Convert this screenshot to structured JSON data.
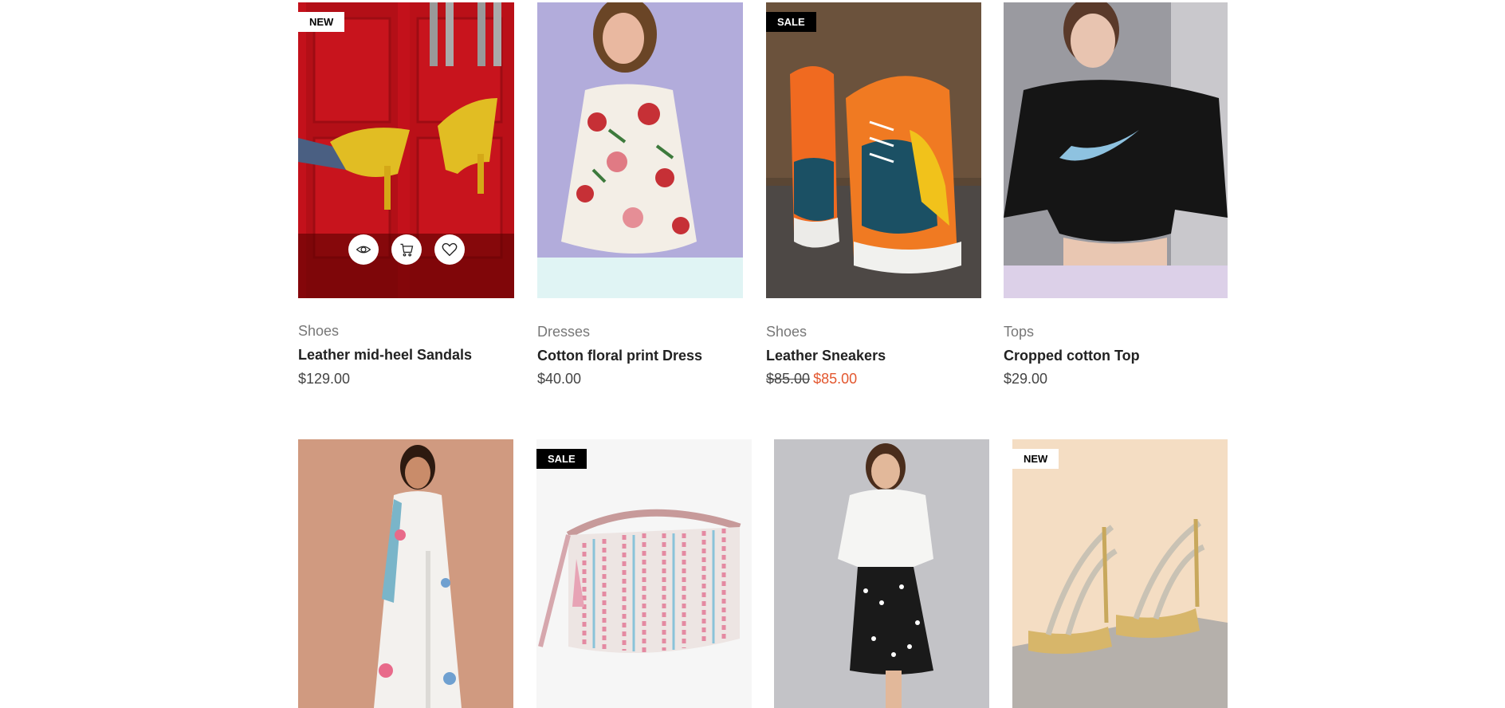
{
  "products_row1": [
    {
      "category": "Shoes",
      "title": "Leather mid-heel Sandals",
      "price": "$129.00",
      "badge": "NEW"
    },
    {
      "category": "Dresses",
      "title": "Cotton floral print Dress",
      "price": "$40.00",
      "badge": ""
    },
    {
      "category": "Shoes",
      "title": "Leather Sneakers",
      "old_price": "$85.00",
      "price": "$85.00",
      "badge": "SALE"
    },
    {
      "category": "Tops",
      "title": "Cropped cotton Top",
      "price": "$29.00",
      "badge": ""
    }
  ],
  "products_row2": [
    {
      "badge": ""
    },
    {
      "badge": "SALE"
    },
    {
      "badge": ""
    },
    {
      "badge": "NEW"
    }
  ],
  "hover_actions": [
    "eye-icon",
    "cart-icon",
    "heart-icon"
  ],
  "colors": {
    "sale_price": "#e3572f",
    "badge_sale_bg": "#000000",
    "badge_new_bg": "#ffffff"
  }
}
